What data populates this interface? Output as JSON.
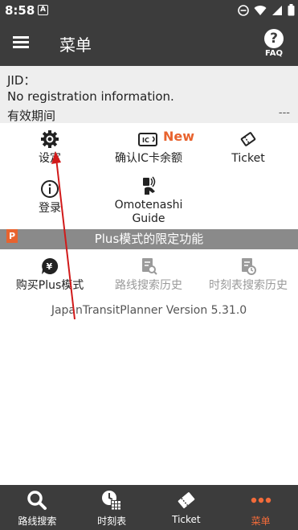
{
  "status_bar": {
    "time": "8:58",
    "notif_letter": "A"
  },
  "header": {
    "title": "菜单",
    "faq_label": "FAQ"
  },
  "account": {
    "jid_label": "JID：",
    "registration": "No registration information.",
    "validity_label": "有效期间",
    "validity_value": "---"
  },
  "menu": {
    "settings": "设定",
    "ic_balance": "确认IC卡余额",
    "ic_new_badge": "New",
    "ticket": "Ticket",
    "login": "登录",
    "omotenashi": "Omotenashi\nGuide"
  },
  "plus": {
    "band_label": "Plus模式的限定功能",
    "badge_letter": "P",
    "buy": "购买Plus模式",
    "route_history": "路线搜索历史",
    "timetable_history": "时刻表搜索历史"
  },
  "version": "JapanTransitPlanner Version 5.31.0",
  "bottom_nav": [
    {
      "label": "路线搜索",
      "icon": "search-icon"
    },
    {
      "label": "时刻表",
      "icon": "timetable-icon"
    },
    {
      "label": "Ticket",
      "icon": "ticket-icon"
    },
    {
      "label": "菜单",
      "icon": "more-icon"
    }
  ],
  "colors": {
    "bar": "#3c3c3c",
    "accent": "#e8632e",
    "band": "#8a8a8a",
    "annotation": "#d11a1a"
  }
}
